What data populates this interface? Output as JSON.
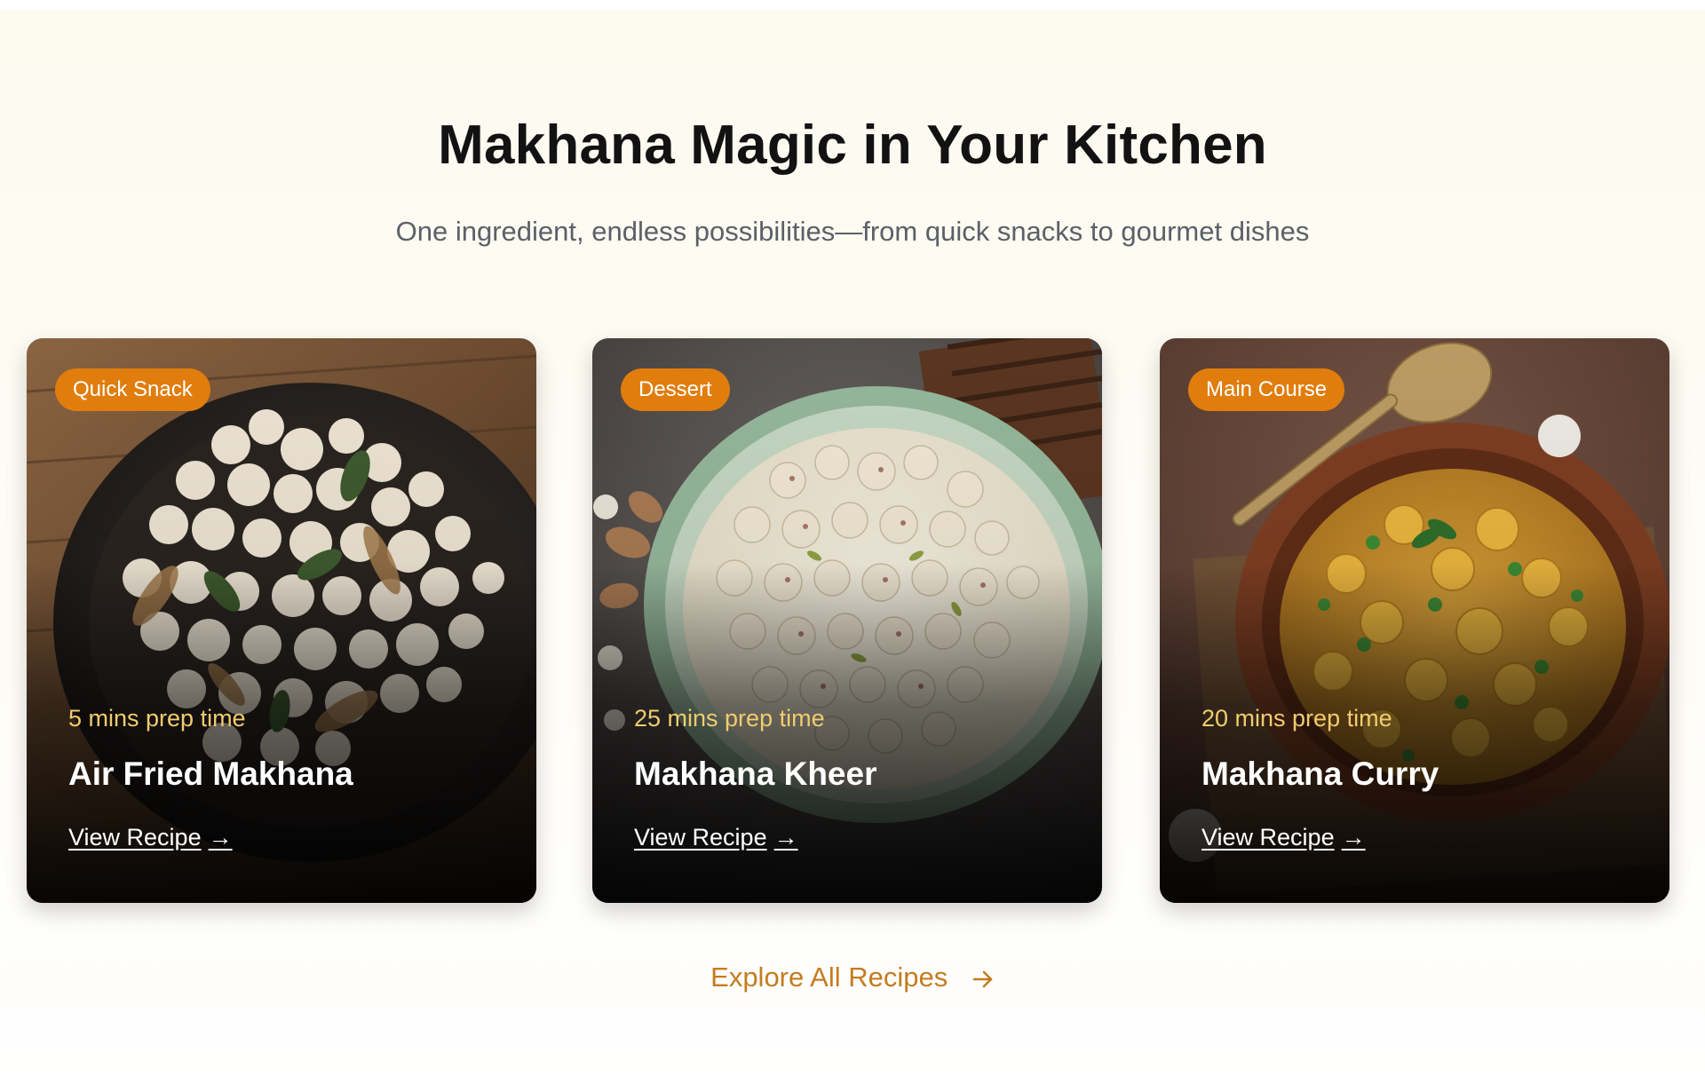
{
  "section": {
    "title": "Makhana Magic in Your Kitchen",
    "subtitle": "One ingredient, endless possibilities—from quick snacks to gourmet dishes"
  },
  "recipes": [
    {
      "category": "Quick Snack",
      "prep_time": "5 mins prep time",
      "name": "Air Fried Makhana",
      "link_label": "View Recipe",
      "link_arrow": "→"
    },
    {
      "category": "Dessert",
      "prep_time": "25 mins prep time",
      "name": "Makhana Kheer",
      "link_label": "View Recipe",
      "link_arrow": "→"
    },
    {
      "category": "Main Course",
      "prep_time": "20 mins prep time",
      "name": "Makhana Curry",
      "link_label": "View Recipe",
      "link_arrow": "→"
    }
  ],
  "explore": {
    "label": "Explore All Recipes",
    "icon": "arrow-right-icon"
  },
  "colors": {
    "accent": "#e07d0d",
    "prep_text": "#f1cc6e",
    "explore_text": "#c47c1f",
    "title_text": "#121212",
    "subtitle_text": "#5b6068"
  }
}
